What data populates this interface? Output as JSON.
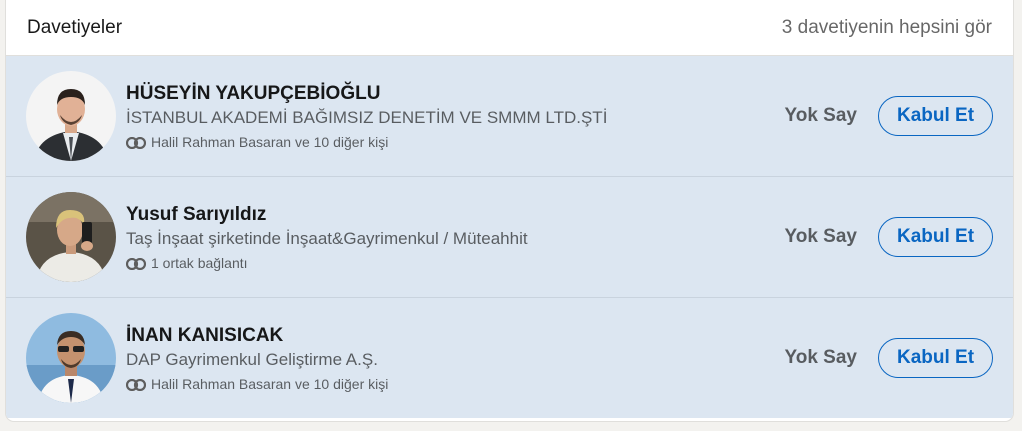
{
  "header": {
    "title": "Davetiyeler",
    "see_all_label": "3 davetiyenin hepsini gör"
  },
  "invitations": [
    {
      "name": "HÜSEYİN YAKUPÇEBİOĞLU",
      "headline": "İSTANBUL AKADEMİ BAĞIMSIZ DENETİM VE SMMM LTD.ŞTİ",
      "mutual": "Halil Rahman Basaran ve 10 diğer kişi",
      "ignore_label": "Yok Say",
      "accept_label": "Kabul Et"
    },
    {
      "name": "Yusuf Sarıyıldız",
      "headline": "Taş İnşaat şirketinde İnşaat&Gayrimenkul / Müteahhit",
      "mutual": "1 ortak bağlantı",
      "ignore_label": "Yok Say",
      "accept_label": "Kabul Et"
    },
    {
      "name": "İNAN KANISICAK",
      "headline": "DAP Gayrimenkul Geliştirme A.Ş.",
      "mutual": "Halil Rahman Basaran ve 10 diğer kişi",
      "ignore_label": "Yok Say",
      "accept_label": "Kabul Et"
    }
  ],
  "colors": {
    "row_background": "#dce6f1",
    "accent": "#0a66c2"
  },
  "icons": {
    "mutual": "mutual-connections-icon"
  }
}
